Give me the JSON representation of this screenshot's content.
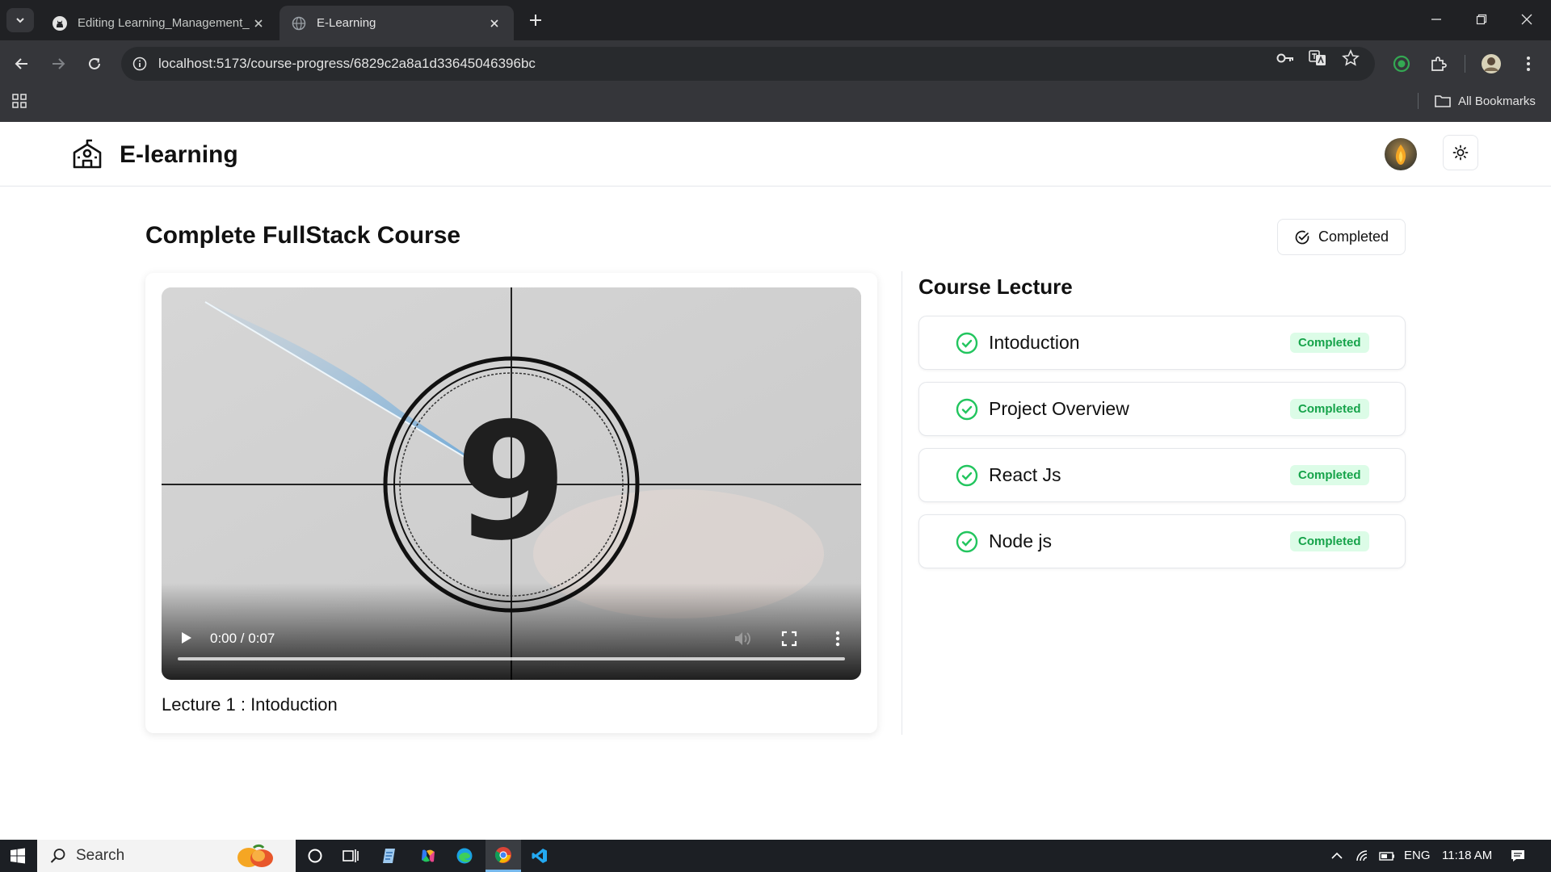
{
  "browser": {
    "tabs": [
      {
        "title": "Editing Learning_Management_",
        "favicon": "github-icon",
        "active": false
      },
      {
        "title": "E-Learning",
        "favicon": "globe-icon",
        "active": true
      }
    ],
    "url": "localhost:5173/course-progress/6829c2a8a1d33645046396bc",
    "bookmarks_label": "All Bookmarks"
  },
  "header": {
    "brand": "E-learning",
    "brand_icon": "school-icon",
    "theme_icon": "sun-icon"
  },
  "course": {
    "title": "Complete FullStack Course",
    "status_button": "Completed"
  },
  "video": {
    "countdown_digit": "9",
    "time": "0:00 / 0:07",
    "progress": 0,
    "caption": "Lecture 1 : Intoduction"
  },
  "lectures": {
    "heading": "Course Lecture",
    "items": [
      {
        "title": "Intoduction",
        "status": "Completed"
      },
      {
        "title": "Project Overview",
        "status": "Completed"
      },
      {
        "title": "React Js",
        "status": "Completed"
      },
      {
        "title": "Node js",
        "status": "Completed"
      }
    ]
  },
  "taskbar": {
    "search_placeholder": "Search",
    "language": "ENG",
    "clock": "11:18 AM"
  },
  "colors": {
    "completed_badge_bg": "#dcfce7",
    "completed_badge_text": "#16a34a",
    "check_icon": "#22c55e"
  }
}
